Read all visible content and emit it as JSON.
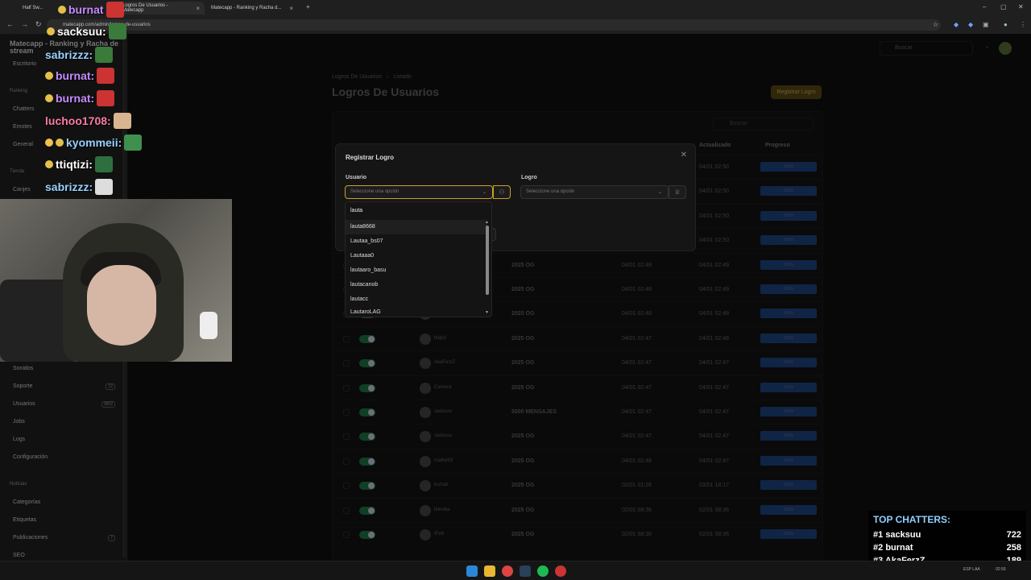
{
  "browser": {
    "tabs": [
      {
        "label": "Half Sw...",
        "active": false
      },
      {
        "label": "Logros De Usuarios - Matecapp",
        "active": true
      },
      {
        "label": "Matecapp - Ranking y Racha d...",
        "active": false
      }
    ],
    "url": "matecapp.com/admin/logros-de-usuarios"
  },
  "sidebar": {
    "title": "Matecapp - Ranking y Racha de stream",
    "items_top": [
      "Escritorio"
    ],
    "section_ranking": "Ranking",
    "ranking_items": [
      "Chatters",
      "Emotes",
      "General"
    ],
    "section_tienda": "Tienda",
    "tienda_items": [
      "Canjes"
    ],
    "items_bottom": [
      {
        "label": "Sonidos",
        "count": ""
      },
      {
        "label": "Soporte",
        "count": "12"
      },
      {
        "label": "Usuarios",
        "count": "9802"
      },
      {
        "label": "Jobs",
        "count": ""
      },
      {
        "label": "Logs",
        "count": ""
      },
      {
        "label": "Configuración",
        "count": ""
      }
    ],
    "section_noticias": "Noticias",
    "noticias_items": [
      {
        "label": "Categorías",
        "count": ""
      },
      {
        "label": "Etiquetas",
        "count": ""
      },
      {
        "label": "Publicaciones",
        "count": "7"
      },
      {
        "label": "SEO",
        "count": ""
      }
    ]
  },
  "topbar": {
    "search_placeholder": "Buscar"
  },
  "breadcrumb": [
    "Logros De Usuarios",
    "›",
    "Listado"
  ],
  "page_title": "Logros De Usuarios",
  "register_button": "Registrar Logro",
  "table": {
    "search_placeholder": "Buscar",
    "headers": {
      "updated": "Actualizado",
      "progress": "Progreso"
    },
    "rows": [
      {
        "user": "",
        "logro": "",
        "created": "",
        "updated": "04/01 02:50",
        "progress": "100%"
      },
      {
        "user": "",
        "logro": "",
        "created": "",
        "updated": "04/01 02:50",
        "progress": "100%"
      },
      {
        "user": "",
        "logro": "",
        "created": "",
        "updated": "04/01 02:50",
        "progress": "100%"
      },
      {
        "user": "",
        "logro": "",
        "created": "",
        "updated": "04/01 02:50",
        "progress": "100%"
      },
      {
        "user": "",
        "logro": "2025 OG",
        "created": "04/01 02:49",
        "updated": "04/01 02:49",
        "progress": "100%"
      },
      {
        "user": "",
        "logro": "2025 OG",
        "created": "04/01 02:48",
        "updated": "04/01 02:49",
        "progress": "100%"
      },
      {
        "user": "",
        "logro": "2025 OG",
        "created": "04/01 02:48",
        "updated": "04/01 02:48",
        "progress": "100%"
      },
      {
        "user": "ttiqtizi",
        "logro": "2025 OG",
        "created": "04/01 02:47",
        "updated": "04/01 02:48",
        "progress": "100%"
      },
      {
        "user": "AkaFerzZ",
        "logro": "2025 OG",
        "created": "04/01 02:47",
        "updated": "04/01 02:47",
        "progress": "100%"
      },
      {
        "user": "Camera",
        "logro": "2025 OG",
        "created": "04/01 02:47",
        "updated": "04/01 02:47",
        "progress": "100%"
      },
      {
        "user": "sacksuu",
        "logro": "5000 MENSAJES",
        "created": "04/01 02:47",
        "updated": "04/01 02:47",
        "progress": "100%"
      },
      {
        "user": "sacksuu",
        "logro": "2025 OG",
        "created": "04/01 02:47",
        "updated": "04/01 02:47",
        "progress": "100%"
      },
      {
        "user": "matheh3",
        "logro": "2025 OG",
        "created": "04/01 02:46",
        "updated": "04/01 02:47",
        "progress": "100%"
      },
      {
        "user": "burnat",
        "logro": "2025 OG",
        "created": "02/01 01:26",
        "updated": "03/01 18:17",
        "progress": "100%"
      },
      {
        "user": "lirinoba",
        "logro": "2025 OG",
        "created": "02/01 08:36",
        "updated": "02/01 08:36",
        "progress": "100%"
      },
      {
        "user": "IFett",
        "logro": "2025 OG",
        "created": "02/01 08:36",
        "updated": "02/01 08:36",
        "progress": "100%"
      }
    ]
  },
  "modal": {
    "title": "Registrar Logro",
    "user_label": "Usuario",
    "user_placeholder": "Seleccione una opción",
    "logro_label": "Logro",
    "logro_placeholder": "Seleccione una opción"
  },
  "dropdown": {
    "query": "lauta",
    "options": [
      "lauta8668",
      "Lautaa_bs07",
      "Lautaaa0",
      "lautaaro_basu",
      "lautacanob",
      "lautacc",
      "LautaroLAG"
    ]
  },
  "chat": [
    {
      "user": "burnat",
      "color": "#c58cff"
    },
    {
      "user": "sacksuu:",
      "color": "#ffffff"
    },
    {
      "user": "sabrizzz:",
      "color": "#9ad0ff"
    },
    {
      "user": "burnat:",
      "color": "#c58cff"
    },
    {
      "user": "burnat:",
      "color": "#c58cff"
    },
    {
      "user": "luchoo1708:",
      "color": "#ff7aa8"
    },
    {
      "user": "kyommeii:",
      "color": "#9ad0ff"
    },
    {
      "user": "ttiqtizi:",
      "color": "#ffffff"
    },
    {
      "user": "sabrizzz:",
      "color": "#9ad0ff"
    }
  ],
  "top_chatters": {
    "title": "TOP CHATTERS:",
    "rows": [
      {
        "rank": "#1",
        "name": "sacksuu",
        "count": "722"
      },
      {
        "rank": "#2",
        "name": "burnat",
        "count": "258"
      },
      {
        "rank": "#3",
        "name": "AkaFerzZ",
        "count": "189"
      }
    ]
  },
  "tray": {
    "lang": "ESP LAA",
    "time": "02:50"
  }
}
